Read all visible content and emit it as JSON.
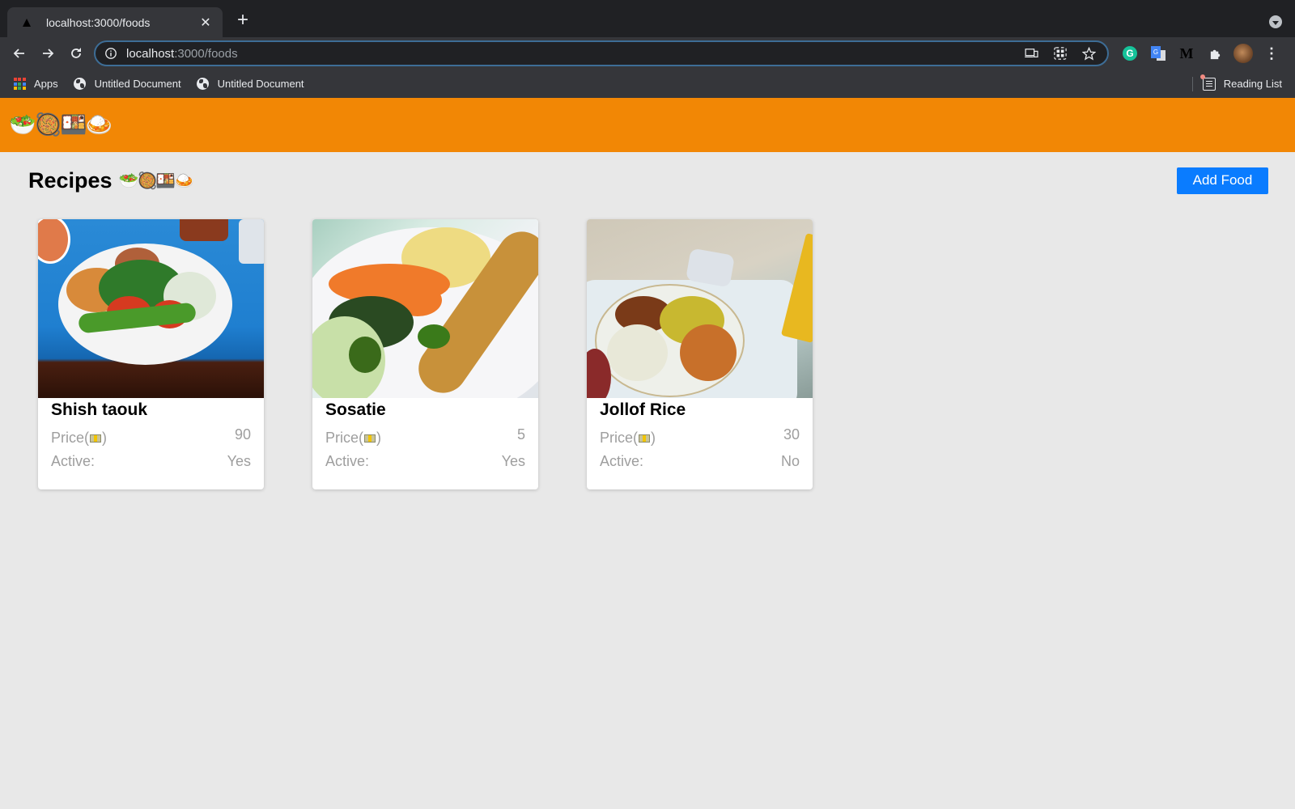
{
  "browser": {
    "tab": {
      "title": "localhost:3000/foods"
    },
    "address": {
      "host": "localhost",
      "path": ":3000/foods"
    },
    "bookmarks": [
      {
        "label": "Apps",
        "icon": "apps-grid-icon"
      },
      {
        "label": "Untitled Document",
        "icon": "globe-icon"
      },
      {
        "label": "Untitled Document",
        "icon": "globe-icon"
      }
    ],
    "reading_list": "Reading List",
    "extensions": [
      "grammarly-icon",
      "google-translate-icon",
      "medium-icon",
      "extensions-puzzle-icon"
    ]
  },
  "app": {
    "logo_emoji": "🥗🥘🍱🍛",
    "accent": "#f28705",
    "primary_button_color": "#0a7cff"
  },
  "page": {
    "title": "Recipes",
    "title_emoji": "🥗🥘🍱🍛",
    "add_button": "Add Food"
  },
  "foods": [
    {
      "name": "Shish taouk",
      "price_label": "Price(",
      "price_suffix": ")",
      "price": "90",
      "active_label": "Active:",
      "active": "Yes",
      "image": "plate with chicken, bulgur, parsley, tomato, green pepper"
    },
    {
      "name": "Sosatie",
      "price_label": "Price(",
      "price_suffix": ")",
      "price": "5",
      "active_label": "Active:",
      "active": "Yes",
      "image": "skewer with mashed potato, carrots, spinach, salad"
    },
    {
      "name": "Jollof Rice",
      "price_label": "Price(",
      "price_suffix": ")",
      "price": "30",
      "active_label": "Active:",
      "active": "No",
      "image": "plate with jollof rice, chicken, coleslaw on tray"
    }
  ]
}
